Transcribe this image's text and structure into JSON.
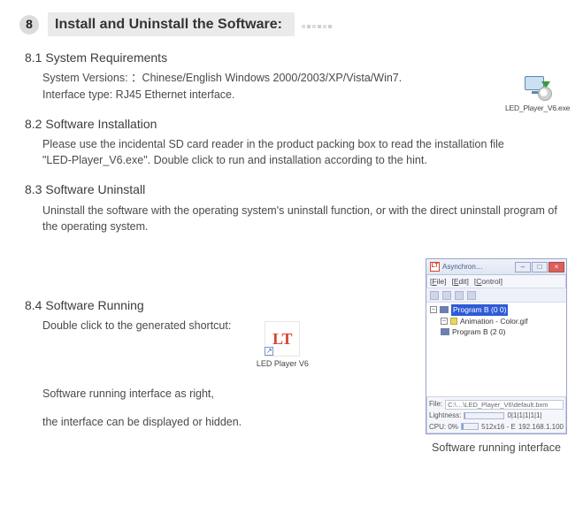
{
  "header": {
    "number": "8",
    "title": "Install and Uninstall the Software:"
  },
  "s81": {
    "title": "8.1 System Requirements",
    "line1": "System Versions: ：Chinese/English Windows 2000/2003/XP/Vista/Win7.",
    "line2": "Interface type: RJ45 Ethernet interface."
  },
  "installer": {
    "label": "LED_Player_V6.exe"
  },
  "s82": {
    "title": "8.2 Software Installation",
    "para": "Please use the incidental SD card reader in the product packing box to read the installation file \"LED-Player_V6.exe\". Double click to run and installation according to the hint."
  },
  "s83": {
    "title": "8.3 Software Uninstall",
    "para": "Uninstall the software with the operating system's uninstall function, or with the direct uninstall program of the operating system."
  },
  "s84": {
    "title": "8.4 Software Running",
    "line1": "Double click to the generated shortcut:",
    "line2": "Software running interface as right,",
    "line3": "the interface can be displayed or hidden."
  },
  "shortcut": {
    "logo": "LT",
    "label": "LED Player V6"
  },
  "app": {
    "titlebar": {
      "logo": "LT",
      "title": "Asynchron…"
    },
    "win_buttons": {
      "min": "–",
      "max": "□",
      "close": "×"
    },
    "menu": {
      "file": "File",
      "edit": "Edit",
      "control": "Control"
    },
    "tree": {
      "root": "Program B (0 0)",
      "anim": "Animation - Color.gif",
      "sub": "Program B (2 0)"
    },
    "status": {
      "file_label": "File:",
      "file_path": "C:\\…\\LED_Player_V6\\default.bxm",
      "light_label": "Lightness:",
      "light_scale": "0|1|1|1|1|1|",
      "cpu_label": "CPU: 0%",
      "size": "512x16 - E",
      "ip": "192.168.1.100"
    }
  },
  "caption": "Software running interface"
}
